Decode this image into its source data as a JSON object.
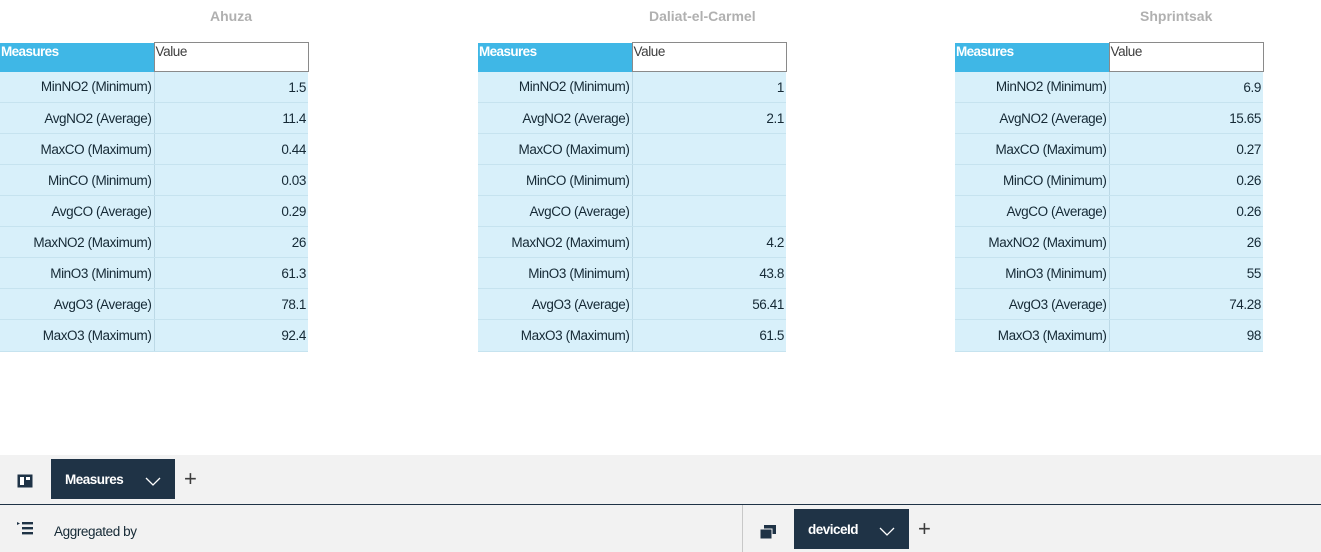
{
  "columns_header": {
    "measures": "Measures",
    "value": "Value"
  },
  "panels": [
    {
      "title": "Ahuza",
      "rows": [
        {
          "measure": "MinNO2 (Minimum)",
          "value": "1.5"
        },
        {
          "measure": "AvgNO2 (Average)",
          "value": "11.4"
        },
        {
          "measure": "MaxCO (Maximum)",
          "value": "0.44"
        },
        {
          "measure": "MinCO (Minimum)",
          "value": "0.03"
        },
        {
          "measure": "AvgCO (Average)",
          "value": "0.29"
        },
        {
          "measure": "MaxNO2 (Maximum)",
          "value": "26"
        },
        {
          "measure": "MinO3 (Minimum)",
          "value": "61.3"
        },
        {
          "measure": "AvgO3 (Average)",
          "value": "78.1"
        },
        {
          "measure": "MaxO3 (Maximum)",
          "value": "92.4"
        }
      ]
    },
    {
      "title": "Daliat-el-Carmel",
      "rows": [
        {
          "measure": "MinNO2 (Minimum)",
          "value": "1"
        },
        {
          "measure": "AvgNO2 (Average)",
          "value": "2.1"
        },
        {
          "measure": "MaxCO (Maximum)",
          "value": ""
        },
        {
          "measure": "MinCO (Minimum)",
          "value": ""
        },
        {
          "measure": "AvgCO (Average)",
          "value": ""
        },
        {
          "measure": "MaxNO2 (Maximum)",
          "value": "4.2"
        },
        {
          "measure": "MinO3 (Minimum)",
          "value": "43.8"
        },
        {
          "measure": "AvgO3 (Average)",
          "value": "56.41"
        },
        {
          "measure": "MaxO3 (Maximum)",
          "value": "61.5"
        }
      ]
    },
    {
      "title": "Shprintsak",
      "rows": [
        {
          "measure": "MinNO2 (Minimum)",
          "value": "6.9"
        },
        {
          "measure": "AvgNO2 (Average)",
          "value": "15.65"
        },
        {
          "measure": "MaxCO (Maximum)",
          "value": "0.27"
        },
        {
          "measure": "MinCO (Minimum)",
          "value": "0.26"
        },
        {
          "measure": "AvgCO (Average)",
          "value": "0.26"
        },
        {
          "measure": "MaxNO2 (Maximum)",
          "value": "26"
        },
        {
          "measure": "MinO3 (Minimum)",
          "value": "55"
        },
        {
          "measure": "AvgO3 (Average)",
          "value": "74.28"
        },
        {
          "measure": "MaxO3 (Maximum)",
          "value": "98"
        }
      ]
    }
  ],
  "rows_bar": {
    "layout_icon": "panel-layout-icon",
    "pill_label": "Measures",
    "add_label": "+"
  },
  "columns_bar": {
    "aggregated_icon": "list-icon",
    "aggregated_label": "Aggregated by",
    "group_icon": "stacked-cards-icon",
    "pill_label": "deviceId",
    "add_label": "+"
  },
  "colors": {
    "header_blue": "#3fb7e6",
    "cell_blue": "#d8f0fa",
    "pill_navy": "#1f3346",
    "title_gray": "#b0b0b0"
  }
}
